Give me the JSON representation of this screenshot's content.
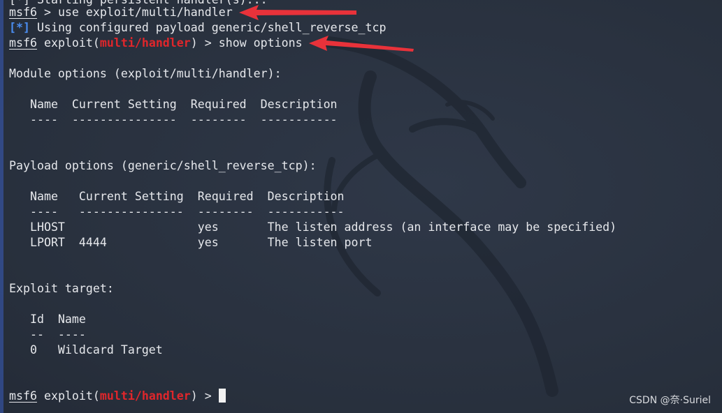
{
  "terminal": {
    "top_cut": "[*] Starting persistent handler(s)...",
    "prompt_name": "msf6",
    "line1_cmd": " > use exploit/multi/handler",
    "info_tag": "[*]",
    "info_text": " Using configured payload generic/shell_reverse_tcp",
    "exploit_pre": " exploit(",
    "module": "multi/handler",
    "line3_post": ") > show options",
    "module_options_heading": "Module options (exploit/multi/handler):",
    "module_table_header": "   Name  Current Setting  Required  Description",
    "module_table_sep": "   ----  ---------------  --------  -----------",
    "payload_options_heading": "Payload options (generic/shell_reverse_tcp):",
    "payload_table_header": "   Name   Current Setting  Required  Description",
    "payload_table_sep": "   ----   ---------------  --------  -----------",
    "payload_rows": [
      "   LHOST                   yes       The listen address (an interface may be specified)",
      "   LPORT  4444             yes       The listen port"
    ],
    "exploit_target_heading": "Exploit target:",
    "target_table_header": "   Id  Name",
    "target_table_sep": "   --  ----",
    "target_row": "   0   Wildcard Target",
    "final_post": ") > "
  },
  "colors": {
    "background": "#2c3442",
    "info_blue": "#4a8df0",
    "module_red": "#e0262b",
    "arrow_red": "#e8323a"
  },
  "watermark": "CSDN @奈·Suriel"
}
